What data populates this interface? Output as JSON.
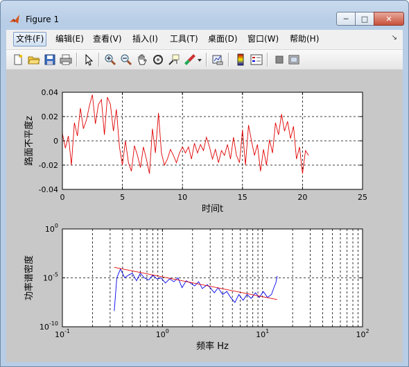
{
  "window": {
    "title": "Figure 1"
  },
  "window_controls": {
    "minimize": "─",
    "maximize": "□",
    "close": "✕"
  },
  "menu": {
    "items": [
      {
        "label": "文件(F)"
      },
      {
        "label": "编辑(E)"
      },
      {
        "label": "查看(V)"
      },
      {
        "label": "插入(I)"
      },
      {
        "label": "工具(T)"
      },
      {
        "label": "桌面(D)"
      },
      {
        "label": "窗口(W)"
      },
      {
        "label": "帮助(H)"
      }
    ],
    "overflow": "↘"
  },
  "toolbar": {
    "icons": [
      "new-file-icon",
      "open-folder-icon",
      "save-icon",
      "print-icon",
      "pointer-icon",
      "zoom-in-icon",
      "zoom-out-icon",
      "pan-hand-icon",
      "rotate-3d-icon",
      "data-cursor-icon",
      "brush-icon",
      "brush-dropdown-icon",
      "link-plot-icon",
      "colorbar-icon",
      "legend-icon",
      "hide-plot-tools-icon",
      "show-plot-tools-icon"
    ]
  },
  "colors": {
    "signal1": "#e00000",
    "signal2": "#0000ee",
    "fit_line": "#e00000",
    "axes_bg": "#ffffff",
    "figure_bg": "#c8c8c8"
  },
  "chart_data": [
    {
      "type": "line",
      "xlabel": "时间t",
      "ylabel": "路面不平度z",
      "xlim": [
        0,
        25
      ],
      "ylim": [
        -0.04,
        0.04
      ],
      "xticks": [
        "0",
        "5",
        "10",
        "15",
        "20",
        "25"
      ],
      "yticks": [
        "-0.04",
        "-0.02",
        "0",
        "0.02",
        "0.04"
      ],
      "grid": true,
      "series": [
        {
          "color": "#e00000",
          "x": [
            0,
            0.25,
            0.5,
            0.75,
            1,
            1.25,
            1.5,
            1.75,
            2,
            2.25,
            2.5,
            2.75,
            3,
            3.25,
            3.5,
            3.75,
            4,
            4.25,
            4.5,
            4.75,
            5,
            5.25,
            5.5,
            5.75,
            6,
            6.25,
            6.5,
            6.75,
            7,
            7.25,
            7.5,
            7.75,
            8,
            8.25,
            8.5,
            8.75,
            9,
            9.25,
            9.5,
            9.75,
            10,
            10.25,
            10.5,
            10.75,
            11,
            11.25,
            11.5,
            11.75,
            12,
            12.25,
            12.5,
            12.75,
            13,
            13.25,
            13.5,
            13.75,
            14,
            14.25,
            14.5,
            14.75,
            15,
            15.25,
            15.5,
            15.75,
            16,
            16.25,
            16.5,
            16.75,
            17,
            17.25,
            17.5,
            17.75,
            18,
            18.25,
            18.5,
            18.75,
            19,
            19.25,
            19.5,
            19.75,
            20,
            20.25,
            20.5
          ],
          "y": [
            0.006,
            -0.006,
            0.004,
            -0.02,
            0.015,
            0.004,
            0.027,
            0.01,
            0.017,
            0.029,
            0.038,
            0.014,
            0.03,
            0.034,
            0.005,
            0.036,
            0.03,
            0.008,
            0.026,
            -0.005,
            -0.02,
            0.0,
            -0.018,
            -0.025,
            -0.004,
            -0.012,
            -0.022,
            -0.005,
            -0.015,
            -0.027,
            0.01,
            -0.01,
            0.023,
            -0.01,
            -0.02,
            -0.015,
            -0.007,
            -0.012,
            -0.018,
            -0.01,
            -0.005,
            -0.01,
            -0.005,
            -0.015,
            -0.002,
            -0.01,
            -0.003,
            -0.008,
            0.003,
            -0.005,
            -0.015,
            -0.007,
            -0.018,
            -0.008,
            -0.012,
            -0.003,
            -0.015,
            0.003,
            -0.012,
            -0.018,
            0.009,
            -0.02,
            0.013,
            0.0,
            -0.012,
            -0.003,
            -0.025,
            -0.007,
            -0.02,
            0.001,
            -0.01,
            0.015,
            0.005,
            0.022,
            0.008,
            0.016,
            0.002,
            0.012,
            -0.015,
            -0.005,
            -0.027,
            -0.008,
            -0.012
          ]
        }
      ]
    },
    {
      "type": "line",
      "xlabel": "频率 Hz",
      "ylabel": "功率谱密度",
      "xscale": "log",
      "yscale": "log",
      "xlim": [
        0.1,
        100
      ],
      "ylim": [
        1e-10,
        1
      ],
      "xticks": [
        {
          "base": "10",
          "exp": "-1"
        },
        {
          "base": "10",
          "exp": "0"
        },
        {
          "base": "10",
          "exp": "1"
        },
        {
          "base": "10",
          "exp": "2"
        }
      ],
      "yticks": [
        {
          "base": "10",
          "exp": "-10"
        },
        {
          "base": "10",
          "exp": "-5"
        },
        {
          "base": "10",
          "exp": "0"
        }
      ],
      "grid": true,
      "series": [
        {
          "color": "#0000ee",
          "x": [
            0.33,
            0.35,
            0.38,
            0.42,
            0.46,
            0.5,
            0.55,
            0.6,
            0.66,
            0.73,
            0.8,
            0.88,
            0.97,
            1.07,
            1.18,
            1.3,
            1.43,
            1.57,
            1.73,
            1.9,
            2.1,
            2.3,
            2.5,
            2.8,
            3.0,
            3.3,
            3.6,
            4.0,
            4.4,
            4.8,
            5.3,
            5.8,
            6.4,
            7.0,
            7.7,
            8.5,
            9.3,
            10.2,
            11.2,
            12.3,
            13.0,
            13.6,
            14.0
          ],
          "y": [
            4e-09,
            1e-05,
            8e-05,
            1e-05,
            2e-05,
            3e-05,
            5e-06,
            3e-05,
            1e-05,
            6e-06,
            2e-05,
            8e-06,
            1e-05,
            3e-06,
            8e-06,
            4e-06,
            1e-05,
            1e-06,
            5e-06,
            3e-06,
            1.5e-06,
            4e-06,
            8e-07,
            2e-06,
            1e-06,
            3e-07,
            1e-06,
            2e-07,
            4e-07,
            1e-07,
            3e-08,
            2e-07,
            5e-08,
            2e-07,
            8e-08,
            3e-07,
            1e-07,
            4e-07,
            1e-07,
            2e-07,
            1e-06,
            3e-06,
            1.5e-05
          ]
        },
        {
          "color": "#e00000",
          "x": [
            0.33,
            14
          ],
          "y": [
            0.00012,
            6e-08
          ]
        }
      ]
    }
  ]
}
